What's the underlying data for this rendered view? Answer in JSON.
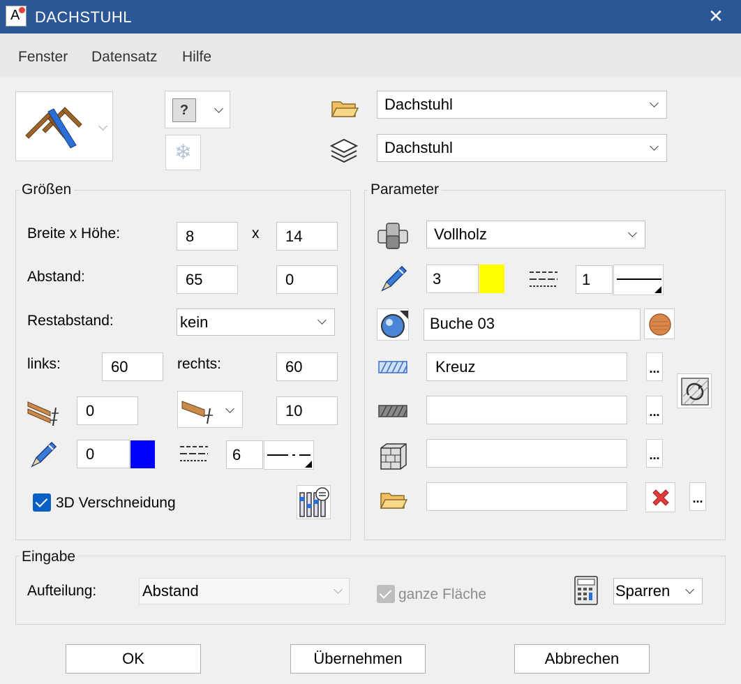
{
  "window": {
    "title": "DACHSTUHL",
    "app_icon_letter": "A",
    "close_glyph": "✕"
  },
  "menu": {
    "items": [
      "Fenster",
      "Datensatz",
      "Hilfe"
    ]
  },
  "top": {
    "folder_combo": "Dachstuhl",
    "layer_combo": "Dachstuhl",
    "help_glyph": "?",
    "snow_glyph": "❄"
  },
  "groessen": {
    "title": "Größen",
    "breite_label": "Breite x Höhe:",
    "breite": "8",
    "x_label": "x",
    "hoehe": "14",
    "abstand_label": "Abstand:",
    "abstand1": "65",
    "abstand2": "0",
    "restabstand_label": "Restabstand:",
    "restabstand": "kein",
    "links_label": "links:",
    "links": "60",
    "rechts_label": "rechts:",
    "rechts": "60",
    "offset1": "0",
    "offset2": "10",
    "pen": "0",
    "pen_color": "#0000ff",
    "line_weight": "6",
    "check_3d_label": "3D Verschneidung"
  },
  "parameter": {
    "title": "Parameter",
    "material_combo": "Vollholz",
    "pen": "3",
    "pen_color": "#ffff00",
    "line_weight": "1",
    "surface": "Buche 03",
    "hatch": "Kreuz",
    "pattern": "",
    "fill": "",
    "resource": "",
    "dots": "..."
  },
  "eingabe": {
    "title": "Eingabe",
    "aufteilung_label": "Aufteilung:",
    "aufteilung": "Abstand",
    "ganze_flaeche_label": "ganze Fläche",
    "sparren_combo": "Sparren"
  },
  "buttons": {
    "ok": "OK",
    "apply": "Übernehmen",
    "cancel": "Abbrechen"
  },
  "colors": {
    "titlebar": "#2b5797",
    "accent": "#0a5fc4"
  }
}
